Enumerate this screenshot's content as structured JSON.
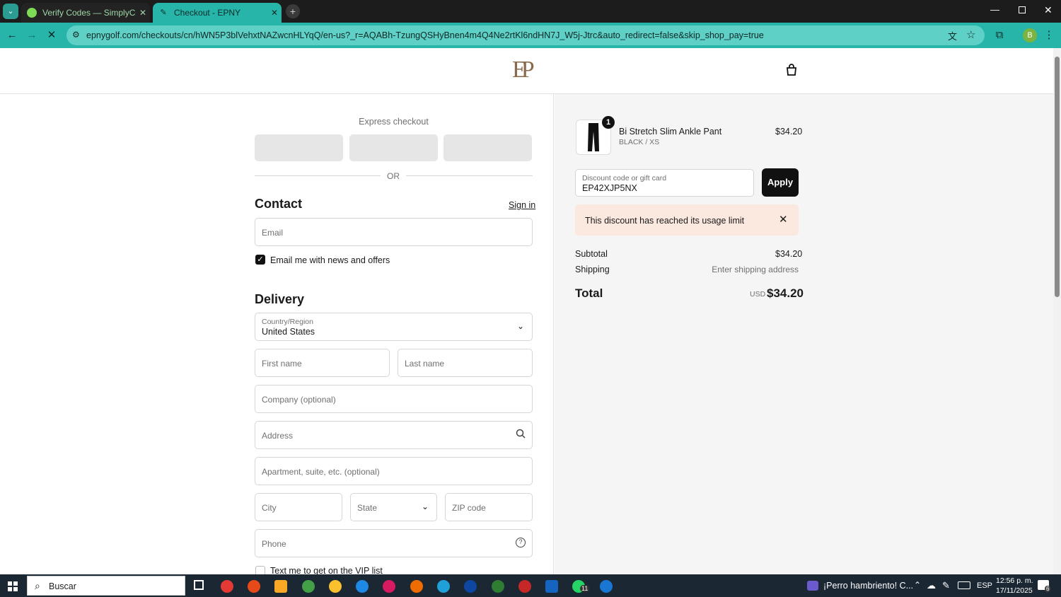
{
  "browser": {
    "tabs": [
      {
        "title": "Verify Codes — SimplyCodes",
        "active": false
      },
      {
        "title": "Checkout - EPNY",
        "active": true
      }
    ],
    "url": "epnygolf.com/checkouts/cn/hWN5P3blVehxtNAZwcnHLYqQ/en-us?_r=AQABh-TzungQSHyBnen4m4Q4Ne2rtKl6ndHN7J_W5j-Jtrc&auto_redirect=false&skip_shop_pay=true",
    "profile_initial": "B"
  },
  "header": {
    "logo": "EP"
  },
  "checkout": {
    "express_label": "Express checkout",
    "or_label": "OR",
    "contact_title": "Contact",
    "sign_in": "Sign in",
    "email_placeholder": "Email",
    "news_label": "Email me with news and offers",
    "news_checked": true,
    "delivery_title": "Delivery",
    "country_label": "Country/Region",
    "country_value": "United States",
    "first_name": "First name",
    "last_name": "Last name",
    "company": "Company (optional)",
    "address": "Address",
    "apartment": "Apartment, suite, etc. (optional)",
    "city": "City",
    "state": "State",
    "zip": "ZIP code",
    "phone": "Phone",
    "vip_label": "Text me to get on the VIP list"
  },
  "summary": {
    "item": {
      "qty": "1",
      "name": "Bi Stretch Slim Ankle Pant",
      "variant": "BLACK / XS",
      "price": "$34.20"
    },
    "discount_label": "Discount code or gift card",
    "discount_value": "EP42XJP5NX",
    "apply": "Apply",
    "error": "This discount has reached its usage limit",
    "subtotal_label": "Subtotal",
    "subtotal_value": "$34.20",
    "shipping_label": "Shipping",
    "shipping_value": "Enter shipping address",
    "total_label": "Total",
    "currency": "USD",
    "total_value": "$34.20"
  },
  "taskbar": {
    "search": "Buscar",
    "notification": "¡Perro hambriento! C...",
    "lang": "ESP",
    "time": "12:56 p. m.",
    "date": "17/11/2025",
    "whatsapp_badge": "11",
    "notif_count": "6"
  }
}
